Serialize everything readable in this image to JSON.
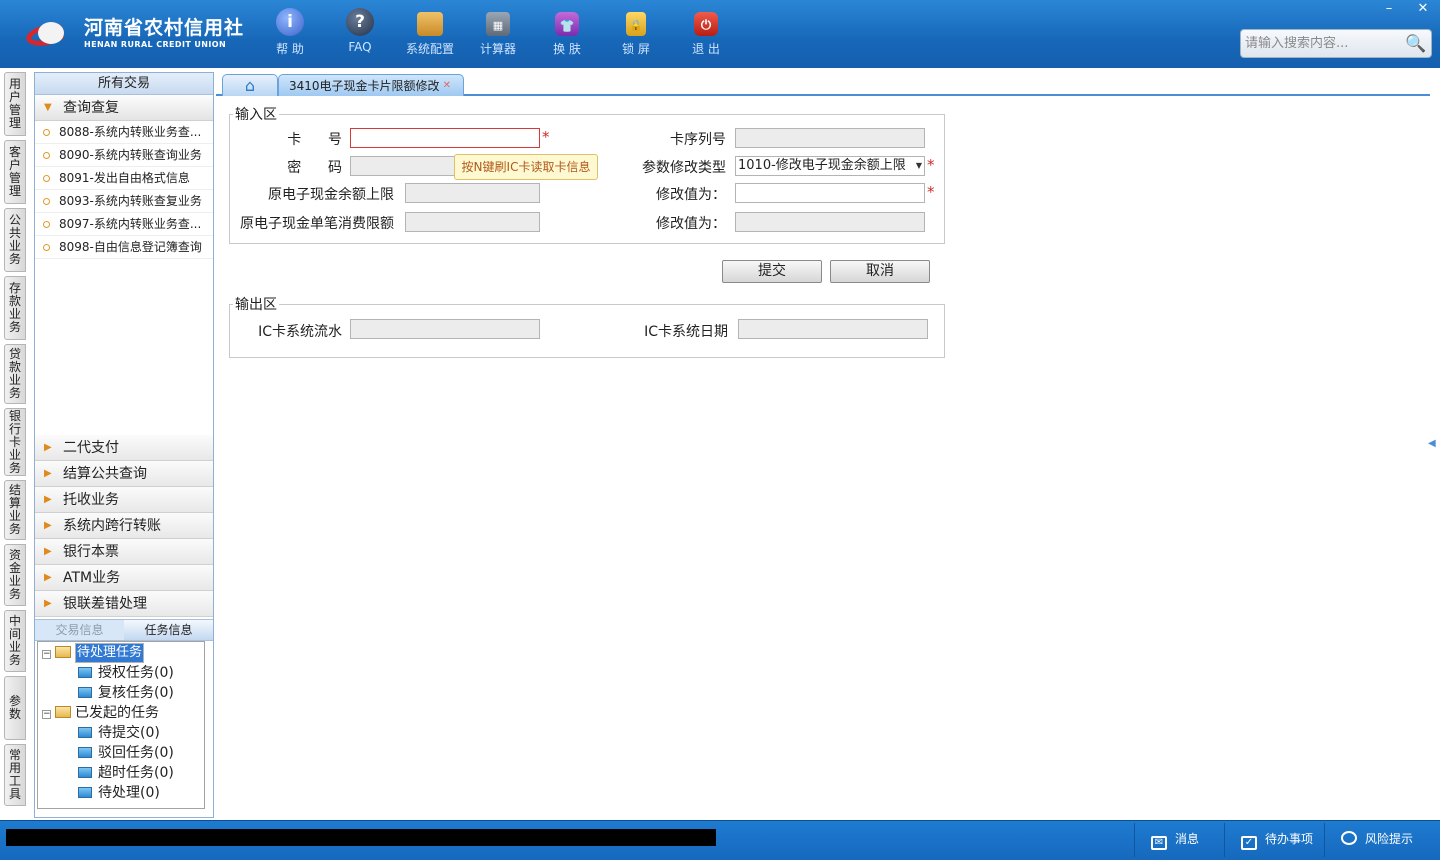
{
  "app": {
    "logo_cn": "河南省农村信用社",
    "logo_en": "HENAN RURAL CREDIT UNION"
  },
  "toolbar": [
    {
      "label": "帮 助",
      "icon": "help-icon",
      "glyph": "i"
    },
    {
      "label": "FAQ",
      "icon": "faq-icon",
      "glyph": "?"
    },
    {
      "label": "系统配置",
      "icon": "toolbox-icon",
      "glyph": ""
    },
    {
      "label": "计算器",
      "icon": "calculator-icon",
      "glyph": "▦"
    },
    {
      "label": "换 肤",
      "icon": "shirt-icon",
      "glyph": "👕"
    },
    {
      "label": "锁 屏",
      "icon": "lock-icon",
      "glyph": "🔒"
    },
    {
      "label": "退 出",
      "icon": "power-icon",
      "glyph": "⏻"
    }
  ],
  "window": {
    "minimize": "–",
    "close": "✕"
  },
  "search": {
    "placeholder": "请输入搜索内容..."
  },
  "left_tabs": [
    "用户管理",
    "客户管理",
    "公共业务",
    "存款业务",
    "贷款业务",
    "银行卡业务",
    "结算业务",
    "资金业务",
    "中间业务",
    "参数",
    "常用工具"
  ],
  "nav": {
    "header": "所有交易",
    "open_group": "查询查复",
    "items": [
      "8088-系统内转账业务查...",
      "8090-系统内转账查询业务",
      "8091-发出自由格式信息",
      "8093-系统内转账查复业务",
      "8097-系统内转账业务查...",
      "8098-自由信息登记簿查询"
    ],
    "groups": [
      "二代支付",
      "结算公共查询",
      "托收业务",
      "系统内跨行转账",
      "银行本票",
      "ATM业务",
      "银联差错处理"
    ]
  },
  "task_panel": {
    "tab_trade": "交易信息",
    "tab_task": "任务信息",
    "pending": {
      "label": "待处理任务",
      "children": [
        "授权任务(0)",
        "复核任务(0)"
      ]
    },
    "started": {
      "label": "已发起的任务",
      "children": [
        "待提交(0)",
        "驳回任务(0)",
        "超时任务(0)",
        "待处理(0)"
      ]
    }
  },
  "tabs": {
    "home_icon": "home-icon",
    "current": "3410电子现金卡片限额修改",
    "close": "✕"
  },
  "form": {
    "input_legend": "输入区",
    "card_no_label": "卡      号",
    "password_label": "密      码",
    "orig_balance_limit_label": "原电子现金余额上限",
    "orig_single_limit_label": "原电子现金单笔消费限额",
    "card_seq_label": "卡序列号",
    "param_type_label": "参数修改类型",
    "param_type_value": "1010-修改电子现金余额上限",
    "modify_to_label_1": "修改值为：",
    "modify_to_label_2": "修改值为：",
    "tooltip": "按N键刷IC卡读取卡信息",
    "required_mark": "*",
    "submit": "提交",
    "cancel": "取消",
    "output_legend": "输出区",
    "ic_serial_label": "IC卡系统流水",
    "ic_date_label": "IC卡系统日期"
  },
  "status": {
    "messages": "消息",
    "todo": "待办事项",
    "risk": "风险提示"
  }
}
